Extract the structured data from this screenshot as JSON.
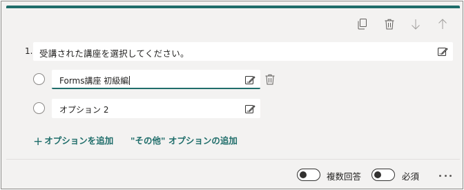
{
  "toolbar": {
    "icons": [
      "copy-icon",
      "trash-icon",
      "arrow-down-icon",
      "arrow-up-icon"
    ]
  },
  "question": {
    "number": "1.",
    "text": "受講された講座を選択してください。"
  },
  "options": [
    {
      "text": "Forms講座 初級編"
    },
    {
      "text": "オプション 2"
    }
  ],
  "actions": {
    "add_option": "オプションを追加",
    "add_other": "\"その他\" オプションの追加"
  },
  "footer": {
    "multiple_answers_label": "複数回答",
    "required_label": "必須",
    "multiple_answers_on": false,
    "required_on": false
  },
  "colors": {
    "accent": "#1f6d6a",
    "card_background": "#f3f2f1"
  }
}
